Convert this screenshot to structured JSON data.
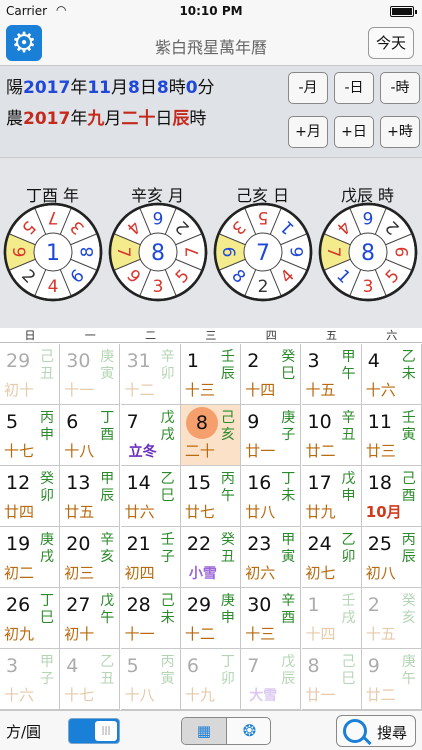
{
  "status": {
    "carrier": "Carrier",
    "time": "10:10 PM"
  },
  "nav": {
    "title": "紫白飛星萬年曆",
    "today_label": "今天"
  },
  "solar": {
    "prefix": "陽",
    "year": "2017",
    "year_unit": "年",
    "month": "11",
    "month_unit": "月",
    "day": "8",
    "day_unit": "日",
    "hour": "8",
    "hour_unit": "時",
    "minute": "0",
    "minute_unit": "分"
  },
  "lunar": {
    "prefix": "農",
    "year": "2017",
    "year_unit": "年",
    "month": "九",
    "month_unit": "月",
    "day": "二十",
    "day_unit": "日",
    "hour_branch": "辰",
    "hour_unit": "時"
  },
  "steppers": {
    "minus_month": "-月",
    "minus_day": "-日",
    "minus_hour": "-時",
    "plus_month": "+月",
    "plus_day": "+日",
    "plus_hour": "+時"
  },
  "pillars": [
    {
      "label": "丁酉 年",
      "center": "1",
      "ring": [
        "9",
        "5",
        "7",
        "3",
        "8",
        "6",
        "4",
        "2"
      ]
    },
    {
      "label": "辛亥 月",
      "center": "8",
      "ring": [
        "7",
        "4",
        "6",
        "2",
        "7",
        "5",
        "3",
        "9"
      ]
    },
    {
      "label": "己亥 日",
      "center": "7",
      "ring": [
        "6",
        "3",
        "5",
        "1",
        "6",
        "4",
        "2",
        "8"
      ]
    },
    {
      "label": "戊辰 時",
      "center": "8",
      "ring": [
        "7",
        "4",
        "6",
        "2",
        "9",
        "5",
        "3",
        "1"
      ]
    }
  ],
  "weekdays": [
    "日",
    "一",
    "二",
    "三",
    "四",
    "五",
    "六"
  ],
  "calendar": [
    [
      {
        "d": "29",
        "gz": "己丑",
        "lunar": "初十",
        "out": true
      },
      {
        "d": "30",
        "gz": "庚寅",
        "lunar": "十一",
        "out": true
      },
      {
        "d": "31",
        "gz": "辛卯",
        "lunar": "十二",
        "out": true
      },
      {
        "d": "1",
        "gz": "壬辰",
        "lunar": "十三"
      },
      {
        "d": "2",
        "gz": "癸巳",
        "lunar": "十四"
      },
      {
        "d": "3",
        "gz": "甲午",
        "lunar": "十五"
      },
      {
        "d": "4",
        "gz": "乙未",
        "lunar": "十六"
      }
    ],
    [
      {
        "d": "5",
        "gz": "丙申",
        "lunar": "十七"
      },
      {
        "d": "6",
        "gz": "丁酉",
        "lunar": "十八"
      },
      {
        "d": "7",
        "gz": "戊戌",
        "lunar": "立冬",
        "kind": "term"
      },
      {
        "d": "8",
        "gz": "己亥",
        "lunar": "二十",
        "selected": true
      },
      {
        "d": "9",
        "gz": "庚子",
        "lunar": "廿一"
      },
      {
        "d": "10",
        "gz": "辛丑",
        "lunar": "廿二"
      },
      {
        "d": "11",
        "gz": "壬寅",
        "lunar": "廿三"
      }
    ],
    [
      {
        "d": "12",
        "gz": "癸卯",
        "lunar": "廿四"
      },
      {
        "d": "13",
        "gz": "甲辰",
        "lunar": "廿五"
      },
      {
        "d": "14",
        "gz": "乙巳",
        "lunar": "廿六"
      },
      {
        "d": "15",
        "gz": "丙午",
        "lunar": "廿七"
      },
      {
        "d": "16",
        "gz": "丁未",
        "lunar": "廿八"
      },
      {
        "d": "17",
        "gz": "戊申",
        "lunar": "廿九"
      },
      {
        "d": "18",
        "gz": "己酉",
        "lunar": "10月",
        "kind": "month"
      }
    ],
    [
      {
        "d": "19",
        "gz": "庚戌",
        "lunar": "初二"
      },
      {
        "d": "20",
        "gz": "辛亥",
        "lunar": "初三"
      },
      {
        "d": "21",
        "gz": "壬子",
        "lunar": "初四"
      },
      {
        "d": "22",
        "gz": "癸丑",
        "lunar": "小雪",
        "kind": "term2"
      },
      {
        "d": "23",
        "gz": "甲寅",
        "lunar": "初六"
      },
      {
        "d": "24",
        "gz": "乙卯",
        "lunar": "初七"
      },
      {
        "d": "25",
        "gz": "丙辰",
        "lunar": "初八"
      }
    ],
    [
      {
        "d": "26",
        "gz": "丁巳",
        "lunar": "初九"
      },
      {
        "d": "27",
        "gz": "戊午",
        "lunar": "初十"
      },
      {
        "d": "28",
        "gz": "己未",
        "lunar": "十一"
      },
      {
        "d": "29",
        "gz": "庚申",
        "lunar": "十二"
      },
      {
        "d": "30",
        "gz": "辛酉",
        "lunar": "十三"
      },
      {
        "d": "1",
        "gz": "壬戌",
        "lunar": "十四",
        "out": true
      },
      {
        "d": "2",
        "gz": "癸亥",
        "lunar": "十五",
        "out": true
      }
    ],
    [
      {
        "d": "3",
        "gz": "甲子",
        "lunar": "十六",
        "out": true
      },
      {
        "d": "4",
        "gz": "乙丑",
        "lunar": "十七",
        "out": true
      },
      {
        "d": "5",
        "gz": "丙寅",
        "lunar": "十八",
        "out": true
      },
      {
        "d": "6",
        "gz": "丁卯",
        "lunar": "十九",
        "out": true
      },
      {
        "d": "7",
        "gz": "戊辰",
        "lunar": "大雪",
        "out": true,
        "kind": "term2"
      },
      {
        "d": "8",
        "gz": "己巳",
        "lunar": "廿一",
        "out": true
      },
      {
        "d": "9",
        "gz": "庚午",
        "lunar": "廿二",
        "out": true
      }
    ]
  ],
  "toolbar": {
    "shape_label": "方/圓",
    "search_label": "搜尋"
  },
  "colors": {
    "accent": "#1a7fd6",
    "highlight_wedge": "#f4ec8c",
    "selected_day": "#f5a06c"
  },
  "icons": {
    "settings": "gear-icon",
    "calendar": "calendar-icon",
    "wheel": "wheel-icon",
    "search": "search-icon"
  }
}
